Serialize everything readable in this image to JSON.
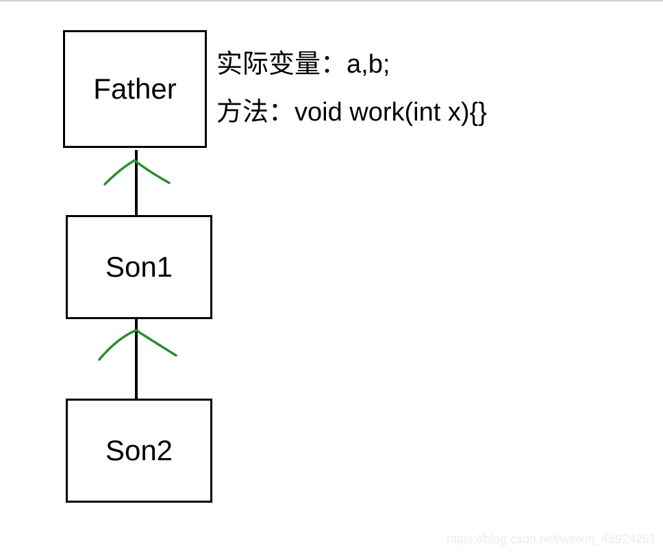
{
  "diagram": {
    "nodes": {
      "father": {
        "label": "Father"
      },
      "son1": {
        "label": "Son1"
      },
      "son2": {
        "label": "Son2"
      }
    },
    "annotations": {
      "variables": "实际变量：a,b;",
      "method": "方法：void work(int x){}"
    },
    "relationships": {
      "son1_to_father": "inherits",
      "son2_to_son1": "inherits"
    }
  },
  "watermark": "https://blog.csdn.net/weixin_45924251"
}
